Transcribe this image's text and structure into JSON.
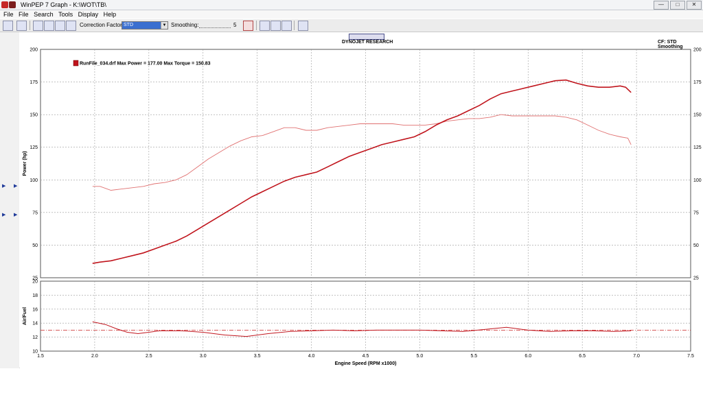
{
  "window": {
    "title": "WinPEP 7    Graph - K:\\WOT\\TB\\",
    "buttons": [
      "—",
      "□",
      "✕"
    ]
  },
  "menu": [
    "File",
    "File",
    "Search",
    "Tools",
    "Display",
    "Help"
  ],
  "toolbar": {
    "correction_label": "Correction Factor:",
    "correction_value": "STD",
    "smoothing_label": "Smoothing:",
    "smoothing_value": "5"
  },
  "graph": {
    "center_title": "DYNOJET RESEARCH",
    "right_info": "CF: STD  Smoothing",
    "legend_text": "RunFile_034.drf Max Power = 177.00 Max Torque = 150.83",
    "colors": {
      "power": "#c0141c",
      "torque": "#e07070",
      "target": "#d04040",
      "grid": "#9a9a9a"
    }
  },
  "chart_data": [
    {
      "type": "line",
      "title": "",
      "ylabel": "Power (hp)",
      "xlabel": "",
      "xlim": [
        1.5,
        7.5
      ],
      "ylim": [
        25,
        200
      ],
      "yticks": [
        25,
        50,
        75,
        100,
        125,
        150,
        175,
        200
      ],
      "grid": true,
      "series": [
        {
          "name": "RunFile_034.drf",
          "x": [
            1.98,
            2.05,
            2.15,
            2.25,
            2.35,
            2.45,
            2.55,
            2.65,
            2.75,
            2.85,
            2.95,
            3.05,
            3.15,
            3.25,
            3.35,
            3.45,
            3.55,
            3.65,
            3.75,
            3.85,
            3.95,
            4.05,
            4.15,
            4.25,
            4.35,
            4.45,
            4.55,
            4.65,
            4.75,
            4.85,
            4.95,
            5.05,
            5.15,
            5.25,
            5.35,
            5.45,
            5.55,
            5.65,
            5.75,
            5.85,
            5.95,
            6.05,
            6.15,
            6.25,
            6.35,
            6.45,
            6.55,
            6.65,
            6.75,
            6.85,
            6.9,
            6.95
          ],
          "values": [
            36,
            37,
            38,
            40,
            42,
            44,
            47,
            50,
            53,
            57,
            62,
            67,
            72,
            77,
            82,
            87,
            91,
            95,
            99,
            102,
            104,
            106,
            110,
            114,
            118,
            121,
            124,
            127,
            129,
            131,
            133,
            137,
            142,
            146,
            149,
            153,
            157,
            162,
            166,
            168,
            170,
            172,
            174,
            176,
            176.5,
            174,
            172,
            171,
            171,
            172,
            171,
            167
          ]
        },
        {
          "name": "",
          "x": [
            1.98,
            2.05,
            2.15,
            2.25,
            2.35,
            2.45,
            2.55,
            2.65,
            2.75,
            2.85,
            2.95,
            3.05,
            3.15,
            3.25,
            3.35,
            3.45,
            3.55,
            3.65,
            3.75,
            3.85,
            3.95,
            4.05,
            4.15,
            4.25,
            4.35,
            4.45,
            4.55,
            4.65,
            4.75,
            4.85,
            4.95,
            5.05,
            5.15,
            5.25,
            5.35,
            5.45,
            5.55,
            5.65,
            5.75,
            5.85,
            5.95,
            6.05,
            6.15,
            6.25,
            6.35,
            6.45,
            6.55,
            6.65,
            6.75,
            6.85,
            6.92,
            6.95
          ],
          "values": [
            95,
            95,
            92,
            93,
            94,
            95,
            97,
            98,
            100,
            104,
            110,
            116,
            121,
            126,
            130,
            133,
            134,
            137,
            140,
            140,
            138,
            138,
            140,
            141,
            142,
            143,
            143,
            143,
            143,
            142,
            142,
            142,
            143,
            145,
            146,
            147,
            147,
            148,
            150,
            149,
            149,
            149,
            149,
            149,
            148,
            146,
            142,
            138,
            135,
            133,
            132,
            127
          ]
        }
      ]
    },
    {
      "type": "line",
      "title": "",
      "ylabel": "Air/Fuel",
      "xlabel": "Engine Speed (RPM x1000)",
      "xlim": [
        1.5,
        7.5
      ],
      "xticks": [
        "1.5",
        "2.0",
        "2.5",
        "3.0",
        "3.5",
        "4.0",
        "4.5",
        "5.0",
        "5.5",
        "6.0",
        "6.5",
        "7.0",
        "7.5"
      ],
      "ylim": [
        10,
        20
      ],
      "yticks": [
        10,
        12,
        14,
        16,
        18,
        20
      ],
      "grid": true,
      "reference_line": 13.0,
      "series": [
        {
          "name": "",
          "x": [
            1.98,
            2.1,
            2.2,
            2.3,
            2.4,
            2.5,
            2.6,
            2.8,
            3.0,
            3.2,
            3.4,
            3.6,
            3.8,
            4.0,
            4.2,
            4.4,
            4.6,
            4.8,
            5.0,
            5.2,
            5.4,
            5.6,
            5.8,
            6.0,
            6.2,
            6.4,
            6.6,
            6.8,
            6.95
          ],
          "values": [
            14.2,
            13.8,
            13.2,
            12.7,
            12.5,
            12.7,
            12.9,
            12.9,
            12.7,
            12.3,
            12.1,
            12.5,
            12.8,
            12.9,
            13.0,
            12.9,
            13.0,
            13.0,
            13.0,
            12.9,
            12.8,
            13.1,
            13.4,
            13.0,
            12.8,
            12.9,
            12.9,
            12.8,
            12.9
          ]
        }
      ]
    }
  ]
}
